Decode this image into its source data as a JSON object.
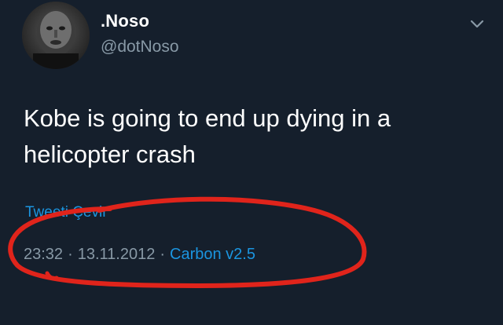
{
  "tweet": {
    "display_name": ".Noso",
    "handle": "@dotNoso",
    "text": "Kobe is going to end up dying in a helicopter crash",
    "translate_label": "Tweeti Çevir",
    "time": "23:32",
    "date": "13.11.2012",
    "separator": "·",
    "source": "Carbon v2.5"
  },
  "icons": {
    "menu": "chevron-down-icon"
  },
  "colors": {
    "background": "#151f2c",
    "primary_text": "#ffffff",
    "secondary_text": "#8899a6",
    "link": "#1b95e0",
    "highlight": "#e0241b"
  }
}
